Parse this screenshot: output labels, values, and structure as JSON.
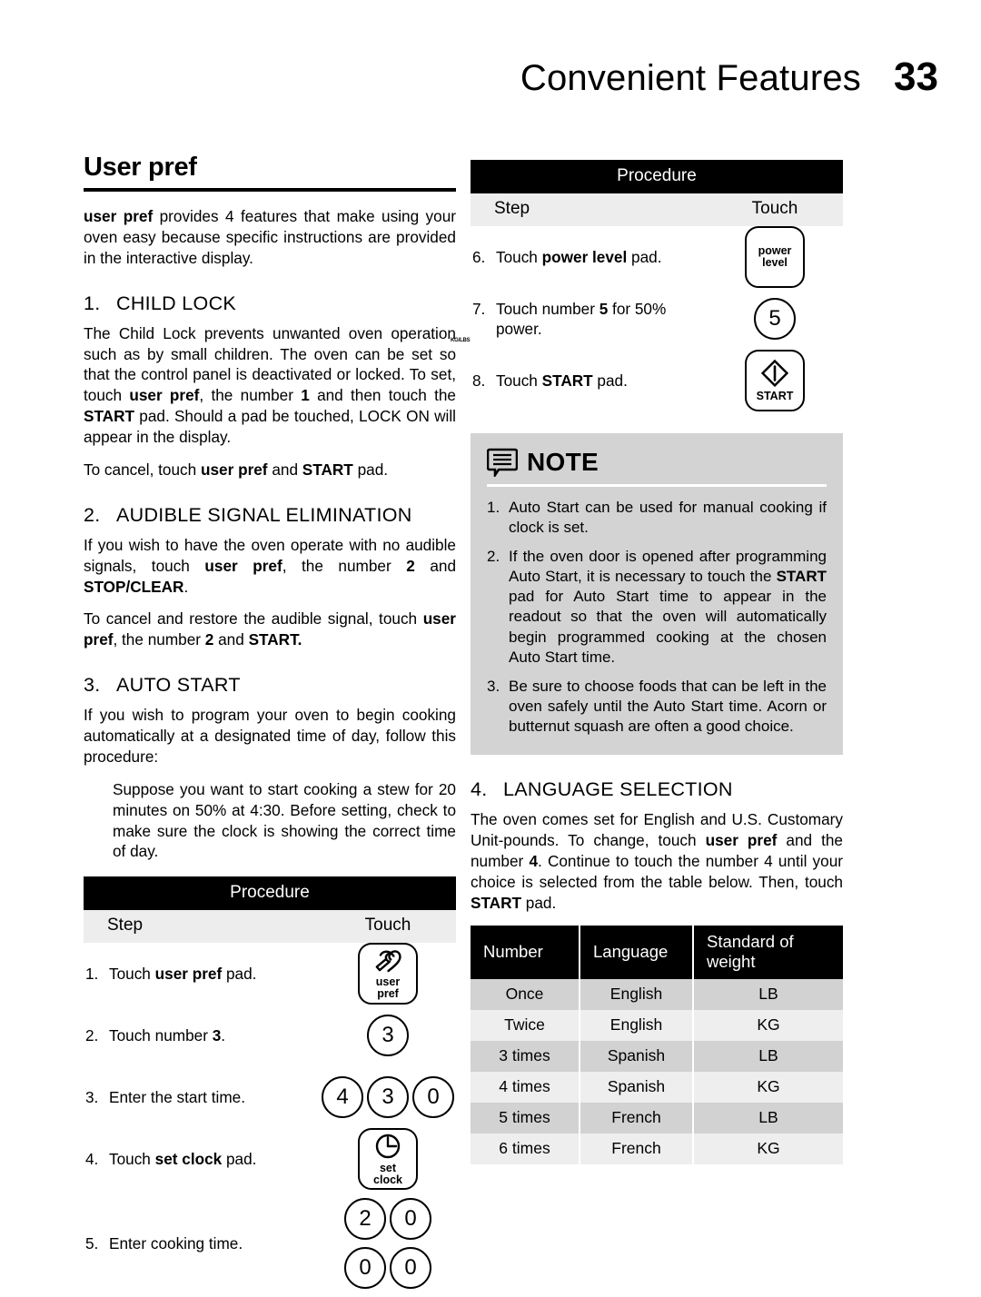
{
  "header": {
    "title": "Convenient Features",
    "page_number": "33"
  },
  "left": {
    "section_title": "User pref",
    "intro_html": "<b>user pref</b> provides 4 features that make using your oven easy because specific instructions are provided in the interactive display.",
    "margin_mark": "KG/LBS",
    "sections": [
      {
        "number": "1.",
        "heading": "CHILD LOCK",
        "paragraphs_html": [
          "The Child Lock prevents unwanted oven operation such as by small children. The oven can be set so that the control panel is deactivated or locked. To set, touch <b>user pref</b>, the number <b>1</b> and then touch the <b>START</b> pad. Should a pad be touched, LOCK ON will appear in the display.",
          "To cancel, touch <b>user pref</b> and <b>START</b> pad."
        ]
      },
      {
        "number": "2.",
        "heading": "AUDIBLE SIGNAL ELIMINATION",
        "paragraphs_html": [
          "If you wish to have the oven operate with no audible signals, touch <b>user pref</b>, the number <b>2</b> and <b>STOP/CLEAR</b>.",
          "To cancel and restore the audible signal, touch <b>user pref</b>, the number <b>2</b> and <b>START.</b>"
        ]
      },
      {
        "number": "3.",
        "heading": "AUTO START",
        "paragraphs_html": [
          "If you wish to program your oven to begin cooking automatically at a designated time of day, follow this procedure:"
        ],
        "indent_html": "Suppose you want to start cooking a stew for 20 minutes on 50% at 4:30. Before setting, check to make sure the clock is showing the correct time of day."
      }
    ],
    "procedure": {
      "title": "Procedure",
      "col_step": "Step",
      "col_touch": "Touch",
      "rows": [
        {
          "index": "1.",
          "text_html": "Touch <b>user pref</b> pad.",
          "pads": [
            {
              "kind": "square-icon",
              "icon": "user-pref-icon",
              "label": "user\npref"
            }
          ]
        },
        {
          "index": "2.",
          "text_html": "Touch number <b>3</b>.",
          "pads": [
            {
              "kind": "round",
              "label": "3"
            }
          ]
        },
        {
          "index": "3.",
          "text_html": "Enter the start time.",
          "pads": [
            {
              "kind": "round",
              "label": "4"
            },
            {
              "kind": "round",
              "label": "3"
            },
            {
              "kind": "round",
              "label": "0"
            }
          ]
        },
        {
          "index": "4.",
          "text_html": "Touch <b>set clock</b> pad.",
          "pads": [
            {
              "kind": "square-icon",
              "icon": "set-clock-icon",
              "label": "set\nclock"
            }
          ]
        },
        {
          "index": "5.",
          "text_html": "Enter cooking time.",
          "pads": [
            {
              "kind": "round",
              "label": "2"
            },
            {
              "kind": "round",
              "label": "0"
            },
            {
              "kind": "round",
              "label": "0"
            },
            {
              "kind": "round",
              "label": "0"
            }
          ]
        }
      ]
    }
  },
  "right": {
    "procedure": {
      "title": "Procedure",
      "col_step": "Step",
      "col_touch": "Touch",
      "rows": [
        {
          "index": "6.",
          "text_html": "Touch <b>power level</b> pad.",
          "pads": [
            {
              "kind": "square-text",
              "label": "power\nlevel"
            }
          ]
        },
        {
          "index": "7.",
          "text_html": "Touch number <b>5</b> for 50% power.",
          "pads": [
            {
              "kind": "round",
              "label": "5"
            }
          ]
        },
        {
          "index": "8.",
          "text_html": "Touch <b>START</b> pad.",
          "pads": [
            {
              "kind": "square-icon",
              "icon": "start-icon",
              "label": "START"
            }
          ]
        }
      ]
    },
    "note": {
      "icon": "note-bubble-icon",
      "title": "NOTE",
      "items_html": [
        "Auto Start can be used for manual cooking if clock is set.",
        "If the oven door is opened after programming Auto Start, it is necessary to touch the <b>START</b> pad for Auto Start time to appear in the readout so that the oven will automatically begin programmed cooking at the chosen Auto Start time.",
        "Be sure to choose foods that can be left in the oven safely until the Auto Start time. Acorn or butternut squash are often a good choice."
      ]
    },
    "language_section": {
      "number": "4.",
      "heading": "LANGUAGE SELECTION",
      "body_html": "The oven comes set for English and U.S. Customary Unit-pounds. To change, touch <b>user pref</b> and the number <b>4</b>. Continue to touch the number 4 until your choice is selected from the table below. Then, touch <b>START</b> pad."
    },
    "language_table": {
      "headers": [
        "Number",
        "Language",
        "Standard of weight"
      ],
      "rows": [
        [
          "Once",
          "English",
          "LB"
        ],
        [
          "Twice",
          "English",
          "KG"
        ],
        [
          "3 times",
          "Spanish",
          "LB"
        ],
        [
          "4 times",
          "Spanish",
          "KG"
        ],
        [
          "5 times",
          "French",
          "LB"
        ],
        [
          "6 times",
          "French",
          "KG"
        ]
      ]
    }
  },
  "colors": {
    "header_band": "#000000",
    "subhead_band": "#ededed",
    "note_bg": "#d3d3d3",
    "row_odd": "#d2d2d2",
    "row_even": "#eeeeee"
  }
}
